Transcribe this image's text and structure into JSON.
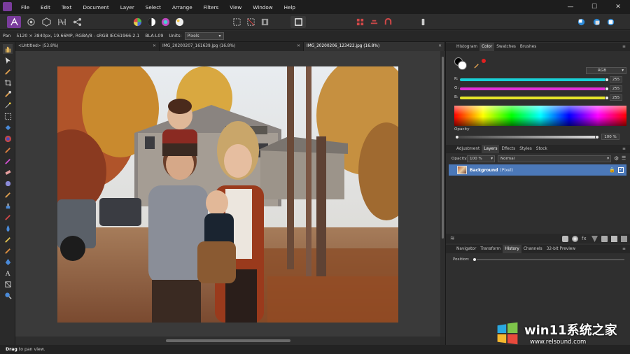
{
  "menubar": {
    "items": [
      "File",
      "Edit",
      "Text",
      "Document",
      "Layer",
      "Select",
      "Arrange",
      "Filters",
      "View",
      "Window",
      "Help"
    ],
    "window_controls": {
      "minimize": "—",
      "maximize": "☐",
      "close": "✕"
    }
  },
  "context_bar": {
    "tool": "Pan",
    "info": "5120 × 3840px, 19.66MP, RGBA/8 - sRGB IEC61966-2.1",
    "camera": "BLA-L09",
    "units_label": "Units:",
    "units_value": "Pixels"
  },
  "tabs": [
    {
      "label": "<Untitled> (53.8%)",
      "close": "✕"
    },
    {
      "label": "IMG_20200207_161639.jpg (16.8%)",
      "close": "✕"
    },
    {
      "label": "IMG_20200206_123422.jpg (16.8%)",
      "close": "✕"
    }
  ],
  "color_panel": {
    "tabs": [
      "Histogram",
      "Color",
      "Swatches",
      "Brushes"
    ],
    "active_tab": "Color",
    "model": "RGB",
    "channels": [
      {
        "label": "R:",
        "value": "255",
        "color": "#19d0d6"
      },
      {
        "label": "G:",
        "value": "255",
        "color": "#e030d8"
      },
      {
        "label": "B:",
        "value": "255",
        "color": "#e6e62a"
      }
    ],
    "opacity_label": "Opacity",
    "opacity_value": "100 %"
  },
  "layers_panel": {
    "tabs": [
      "Adjustment",
      "Layers",
      "Effects",
      "Styles",
      "Stock"
    ],
    "active_tab": "Layers",
    "opacity_label": "Opacity:",
    "opacity_value": "100 %",
    "blend_mode": "Normal",
    "layer_name": "Background",
    "layer_type": "(Pixel)"
  },
  "history_panel": {
    "tabs": [
      "Navigator",
      "Transform",
      "History",
      "Channels",
      "32-bit Preview"
    ],
    "active_tab": "History",
    "position_label": "Position:"
  },
  "status": {
    "bold": "Drag",
    "rest": " to pan view."
  },
  "watermark": {
    "title": "win11系统之家",
    "url": "www.relsound.com"
  },
  "colors": {
    "accent": "#4b78b8",
    "brand": "#7a3c9c"
  }
}
